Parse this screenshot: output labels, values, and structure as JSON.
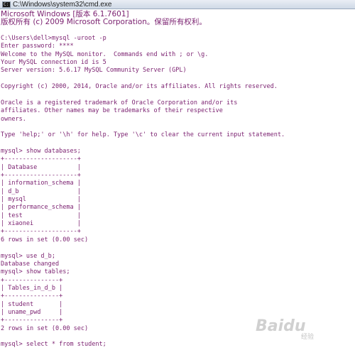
{
  "window": {
    "title": "C:\\Windows\\system32\\cmd.exe",
    "icon": "cmd-icon"
  },
  "console": {
    "text_color": "#7a1f6f",
    "background": "#ffffff",
    "lines": [
      "Microsoft Windows [版本 6.1.7601]",
      "版权所有 (c) 2009 Microsoft Corporation。保留所有权利。",
      "",
      "C:\\Users\\dell>mysql -uroot -p",
      "Enter password: ****",
      "Welcome to the MySQL monitor.  Commands end with ; or \\g.",
      "Your MySQL connection id is 5",
      "Server version: 5.6.17 MySQL Community Server (GPL)",
      "",
      "Copyright (c) 2000, 2014, Oracle and/or its affiliates. All rights reserved.",
      "",
      "Oracle is a registered trademark of Oracle Corporation and/or its",
      "affiliates. Other names may be trademarks of their respective",
      "owners.",
      "",
      "Type 'help;' or '\\h' for help. Type '\\c' to clear the current input statement.",
      "",
      "mysql> show databases;",
      "+--------------------+",
      "| Database           |",
      "+--------------------+",
      "| information_schema |",
      "| d_b                |",
      "| mysql              |",
      "| performance_schema |",
      "| test               |",
      "| xiaonei            |",
      "+--------------------+",
      "6 rows in set (0.00 sec)",
      "",
      "mysql> use d_b;",
      "Database changed",
      "mysql> show tables;",
      "+---------------+",
      "| Tables_in_d_b |",
      "+---------------+",
      "| student       |",
      "| uname_pwd     |",
      "+---------------+",
      "2 rows in set (0.00 sec)",
      "",
      "mysql> select * from student;"
    ]
  },
  "watermark": {
    "brand": "Baidu",
    "sub": "经验"
  }
}
